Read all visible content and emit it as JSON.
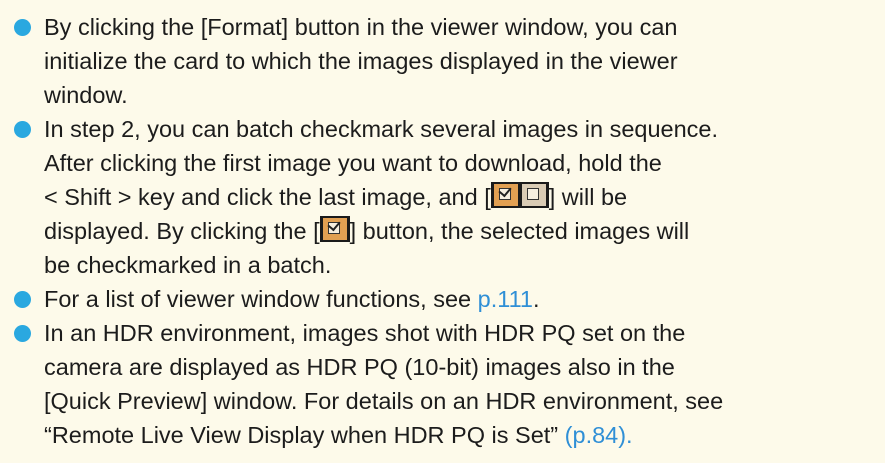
{
  "bullets": [
    {
      "lines": [
        "By clicking the [Format] button in the viewer window, you can",
        "initialize the card to which the images displayed in the viewer",
        "window."
      ]
    },
    {
      "line1": "In step 2, you can batch checkmark several images in sequence.",
      "line2": "After clicking the first image you want to download, hold the",
      "line3_before": "< Shift > key and click the last image, and [",
      "line3_after": "] will be",
      "line4_before": "displayed. By clicking the [",
      "line4_after": "] button, the selected images will",
      "line5": "be checkmarked in a batch.",
      "icons": [
        "checkmark-all-icon",
        "uncheck-all-icon",
        "checkmark-button-icon"
      ]
    },
    {
      "before": "For a list of viewer window functions, see ",
      "link": "p.111",
      "after": "."
    },
    {
      "line1": "In an HDR environment, images shot with HDR PQ set on the",
      "line2": "camera are displayed as HDR PQ (10-bit) images also in the",
      "line3": "[Quick Preview] window. For details on an HDR environment, see",
      "line4_before": "“Remote Live View Display when HDR PQ is Set” ",
      "line4_link": "(p.84).",
      "link_color": "#2f8fd6"
    }
  ],
  "bullet_color": "#2aa8e0"
}
